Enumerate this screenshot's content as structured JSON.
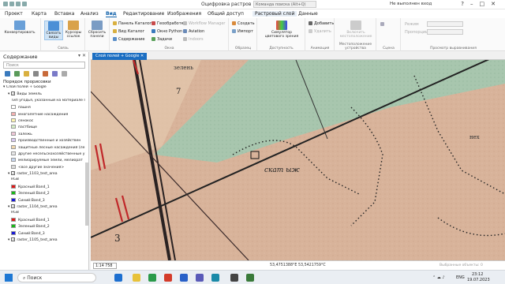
{
  "titlebar": {
    "title": "Оцифровка растров",
    "search": "Команда поиска (Alt+Q)",
    "user": "Не выполнен вход"
  },
  "menu": [
    "Проект",
    "Карта",
    "Вставка",
    "Анализ",
    "Вид",
    "Редактирование",
    "Изображения",
    "Общий доступ",
    "Растровый слой",
    "Данные"
  ],
  "menu_active": "Вид",
  "ribbon": {
    "convert": "Конвертировать",
    "show_views": "Связать виды",
    "cursors": "Курсоры ссылок",
    "reset_panes": "Сбросить панели",
    "group_link": "Связь",
    "catalog_pane": "Панель Каталог",
    "catalog_view": "Вид Каталог",
    "contents": "Содержание",
    "geoprocessing": "Геообработка",
    "python": "Окно Python",
    "tasks": "Задачи",
    "workflow": "Workflow Manager",
    "aviation": "Aviation",
    "indoors": "Indoors",
    "group_window": "Окна",
    "create": "Создать",
    "import": "Импорт",
    "group_samples": "Образец",
    "simulator": "Симулятор цветового зрения",
    "group_access": "Доступность",
    "add": "Добавить",
    "delete": "Удалить",
    "group_anim": "Анимация",
    "enable_loc": "Включить местоположение",
    "group_loc": "Местоположение устройства",
    "group_scene": "Сцена",
    "modes": "Режим",
    "ratio": "Пропорции",
    "group_preview": "Просмотр выравнивания"
  },
  "contents": {
    "title": "Содержание",
    "search_placeholder": "Поиск",
    "order": "Порядок прорисовки",
    "items": [
      {
        "text": "Слой полей + Google",
        "type": "map"
      },
      {
        "text": "Виды земель",
        "type": "layer"
      },
      {
        "text": "Тип угодья, указанный на материале Г",
        "type": "head"
      },
      {
        "text": "пашня",
        "type": "leg",
        "c": "#ffffff"
      },
      {
        "text": "многолетние насаждения",
        "type": "leg",
        "c": "#f3b0b0"
      },
      {
        "text": "сенокос",
        "type": "leg",
        "c": "#fff5b0"
      },
      {
        "text": "пастбище",
        "type": "leg",
        "c": "#d8f0c8"
      },
      {
        "text": "залежь",
        "type": "leg",
        "c": "#f0c8d8"
      },
      {
        "text": "производственные и хозяйствен",
        "type": "leg",
        "c": "#d8c8f0"
      },
      {
        "text": "защитные лесные насаждения (ле",
        "type": "leg",
        "c": "#f0d8b0"
      },
      {
        "text": "другие несельскохозяйственные у",
        "type": "leg",
        "c": "#e8e8e8"
      },
      {
        "text": "мелиорируемые земли, мелиорат",
        "type": "leg",
        "c": "#c8d8f0"
      },
      {
        "text": "<все другие значения>",
        "type": "leg",
        "c": "#dddddd"
      },
      {
        "text": "raster_1103_test_area",
        "type": "layer"
      },
      {
        "text": "RGB",
        "type": "head"
      },
      {
        "text": "Красный:Band_1",
        "type": "leg",
        "c": "#e01818"
      },
      {
        "text": "Зеленый:Band_2",
        "type": "leg",
        "c": "#18b818"
      },
      {
        "text": "Синий:Band_3",
        "type": "leg",
        "c": "#1818d8"
      },
      {
        "text": "raster_1104_test_area",
        "type": "layer"
      },
      {
        "text": "RGB",
        "type": "head"
      },
      {
        "text": "Красный:Band_1",
        "type": "leg",
        "c": "#e01818"
      },
      {
        "text": "Зеленый:Band_2",
        "type": "leg",
        "c": "#18b818"
      },
      {
        "text": "Синий:Band_3",
        "type": "leg",
        "c": "#1818d8"
      },
      {
        "text": "raster_1105_test_area",
        "type": "layer"
      }
    ]
  },
  "map": {
    "tab": "Слой полей + Google",
    "label_ckat": "скат ыж",
    "label_zelen": "зелень",
    "label_7": "7",
    "label_3": "3",
    "label_nekh": "нех"
  },
  "status": {
    "scale": "1:14 758",
    "coords": "53,4751388°E 53,5421759°C",
    "selected": "Выбранные объекты: 0"
  },
  "taskbar": {
    "search": "Поиск",
    "lang": "ENG",
    "time": "23:12",
    "date": "19.07.2023"
  }
}
